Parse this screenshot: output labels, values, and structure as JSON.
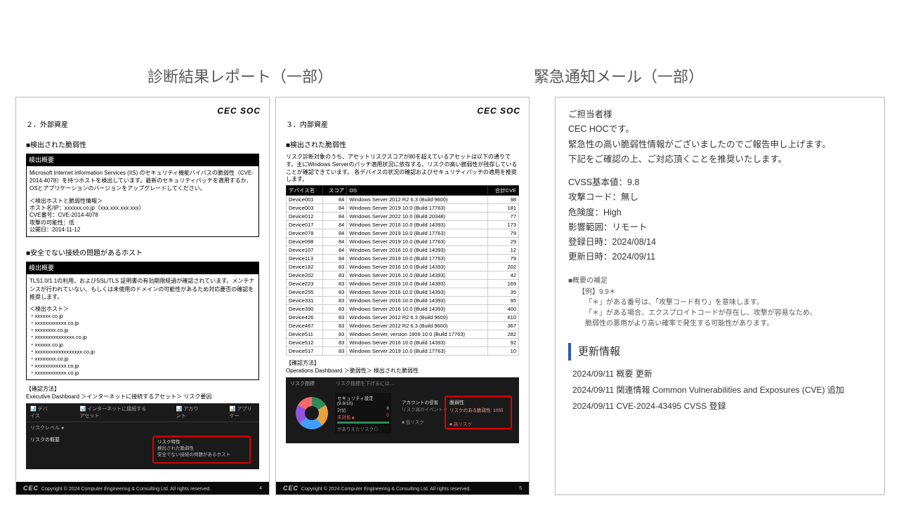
{
  "headings": {
    "left": "診断結果レポート（一部）",
    "right": "緊急通知メール（一部）"
  },
  "brand": "CEC SOC",
  "page1": {
    "section_title": "２．外部資産",
    "sub1": "■検出された脆弱性",
    "box1_header": "検出概要",
    "box1_body": "Microsoft Internet Information Services (IIS) のセキュリティ機能バイパスの脆弱性（CVE-2014-4078）を持つホストを検出しています。最新のセキュリティパッチを適用するか、OSとアプリケーションのバージョンをアップグレードしてください。",
    "box1_meta_title": "＜検出ホストと脆弱性情報＞",
    "box1_meta": [
      "ホスト名/IP：xxxxxx.co.jp（xxx.xxx.xxx.xxx）",
      "CVE番号：CVE-2014-4078",
      "攻撃の可能性：低",
      "公開日：2014-11-12"
    ],
    "sub2": "■安全でない接続の問題があるホスト",
    "box2_header": "検出概要",
    "box2_body": "TLS1.0/1.1の利用、およびSSL/TLS 証明書の有効期限経過が確認されています。メンテナンスが行われていない、もしくは未使用のドメインの可能性があるため対応要否の確認を推奨します。",
    "box2_meta_title": "＜検出ホスト＞",
    "hosts": [
      "・xxxxxx.co.jp",
      "・xxxxxxxxxxxx.co.jp",
      "・xxxxxxxx.co.jp",
      "・xxxxxxxxxxxxxxx.co.jp",
      "・xxxxxx.co.jp",
      "・xxxxxxxxxxxxxxxxxx.co.jp",
      "・xxxxxxxx.co.jp",
      "・xxxxxxxxxxxx.co.jp",
      "・xxxxxxxxxxxx.co.jp"
    ],
    "confirm_label": "【確認方法】",
    "confirm_path": "Executive Dashboard ＞インターネットに接続するアセット＞ リスク要因",
    "dash_tabs": [
      "デバイス",
      "インターネットに接続するアセット",
      "アカウント",
      "アプリケー"
    ],
    "dash_sub": "リスクレベル ●",
    "risk_title": "リスクの概要",
    "risk_box_lines": [
      "リスク特性",
      "検出された脆弱性",
      "安全でない接続の問題があるホスト"
    ],
    "page_no": "4"
  },
  "page2": {
    "section_title": "３．内部資産",
    "sub1": "■検出された脆弱性",
    "desc": "リスク診断対象のうち、アセットリスクスコアが80を超えているアセットは以下の通りです。主にWindows Serverのパッチ適用状況に依存する、リスクの高い脆弱性が残存していることが確認できています。\n各デバイスの状況の確認およびセキュリティパッチの適用を推奨します。",
    "cols": [
      "デバイス名",
      "スコア",
      "OS",
      "合計CVE"
    ],
    "rows": [
      [
        "Device001",
        "84",
        "Windows Server 2012 R2 6.3 (Build 9600)",
        "98"
      ],
      [
        "Device003",
        "84",
        "Windows Server 2019 10.0 (Build 17763)",
        "181"
      ],
      [
        "Device012",
        "84",
        "Windows Server 2022 10.0 (Build 20348)",
        "77"
      ],
      [
        "Device017",
        "84",
        "Windows Server 2016 10.0 (Build 14393)",
        "173"
      ],
      [
        "Device078",
        "84",
        "Windows Server 2019 10.0 (Build 17763)",
        "79"
      ],
      [
        "Device098",
        "84",
        "Windows Server 2019 10.0 (Build 17763)",
        "29"
      ],
      [
        "Device107",
        "84",
        "Windows Server 2016 10.0 (Build 14393)",
        "12"
      ],
      [
        "Device113",
        "84",
        "Windows Server 2019 10.0 (Build 17763)",
        "79"
      ],
      [
        "Device182",
        "83",
        "Windows Server 2016 10.0 (Build 14393)",
        "202"
      ],
      [
        "Device202",
        "83",
        "Windows Server 2016 10.0 (Build 14393)",
        "42"
      ],
      [
        "Device223",
        "83",
        "Windows Server 2016 10.0 (Build 14393)",
        "169"
      ],
      [
        "Device255",
        "83",
        "Windows Server 2016 10.0 (Build 14393)",
        "35"
      ],
      [
        "Device331",
        "83",
        "Windows Server 2016 10.0 (Build 14393)",
        "95"
      ],
      [
        "Device390",
        "83",
        "Windows Server 2016 10.0 (Build 14393)",
        "400"
      ],
      [
        "Device426",
        "83",
        "Windows Server 2012 R2 6.3 (Build 9600)",
        "610"
      ],
      [
        "Device467",
        "83",
        "Windows Server 2012 R2 6.3 (Build 9600)",
        "367"
      ],
      [
        "Device511",
        "83",
        "Windows Server, version 1809 10.0 (Build 17763)",
        "282"
      ],
      [
        "Device512",
        "83",
        "Windows Server 2016 10.0 (Build 14393)",
        "92"
      ],
      [
        "Device517",
        "83",
        "Windows Server 2019 10.0 (Build 17763)",
        "10"
      ]
    ],
    "confirm_label": "【確認方法】",
    "confirm_path": "Operations Dashboard ＞脆弱性＞ 検出された脆弱性",
    "d2_left": "リスク指標",
    "d2_mid": "リスク指標を下げるには…",
    "d2_sec": "セキュリティ設定 (9.8/10)",
    "d2_r1a": "対処",
    "d2_r1b": "未対処▲",
    "d2_gate": "がありえたリスク◎",
    "d2_acc": "アカウントの侵害",
    "d2_acc2": "リスク高のイベント 0",
    "d2_vuln": "脆弱性",
    "d2_vuln2": "リスクのある脆弱性: 1055",
    "d2_lw": "■ 低リスク",
    "d2_hw": "■ 高リスク",
    "page_no": "5"
  },
  "footer_copy": "Copyright © 2024 Computer Engineering & Consulting Ltd. All rights reserved.",
  "footer_logo": "CEC",
  "mail": {
    "greet1": "ご担当者様",
    "greet2": "CEC HOCです。",
    "line1": "緊急性の高い脆弱性情報がございましたのでご報告申し上げます。",
    "line2": "下記をご確認の上、ご対応頂くことを推奨いたします。",
    "fields": {
      "cvss": "CVSS基本値：9.8",
      "code": "攻撃コード：無し",
      "risk": "危険度：High",
      "scope": "影響範囲：リモート",
      "reg": "登録日時：2024/08/14",
      "upd": "更新日時：2024/09/11"
    },
    "supp_title": "■概要の補足",
    "supp_ex": "【例】9.9＊",
    "supp1": "「＊」がある番号は、「攻撃コード有り」を意味します。",
    "supp2": "「＊」がある場合、エクスプロイトコードが存在し、攻撃が容易なため、",
    "supp3": "脆弱性の悪用がより高い確率で発生する可能性があります。",
    "update_title": "更新情報",
    "updates": [
      "2024/09/11 概要 更新",
      "2024/09/11 関連情報 Common Vulnerabilities and Exposures (CVE) 追加",
      "2024/09/11 CVE-2024-43495 CVSS 登録"
    ]
  }
}
